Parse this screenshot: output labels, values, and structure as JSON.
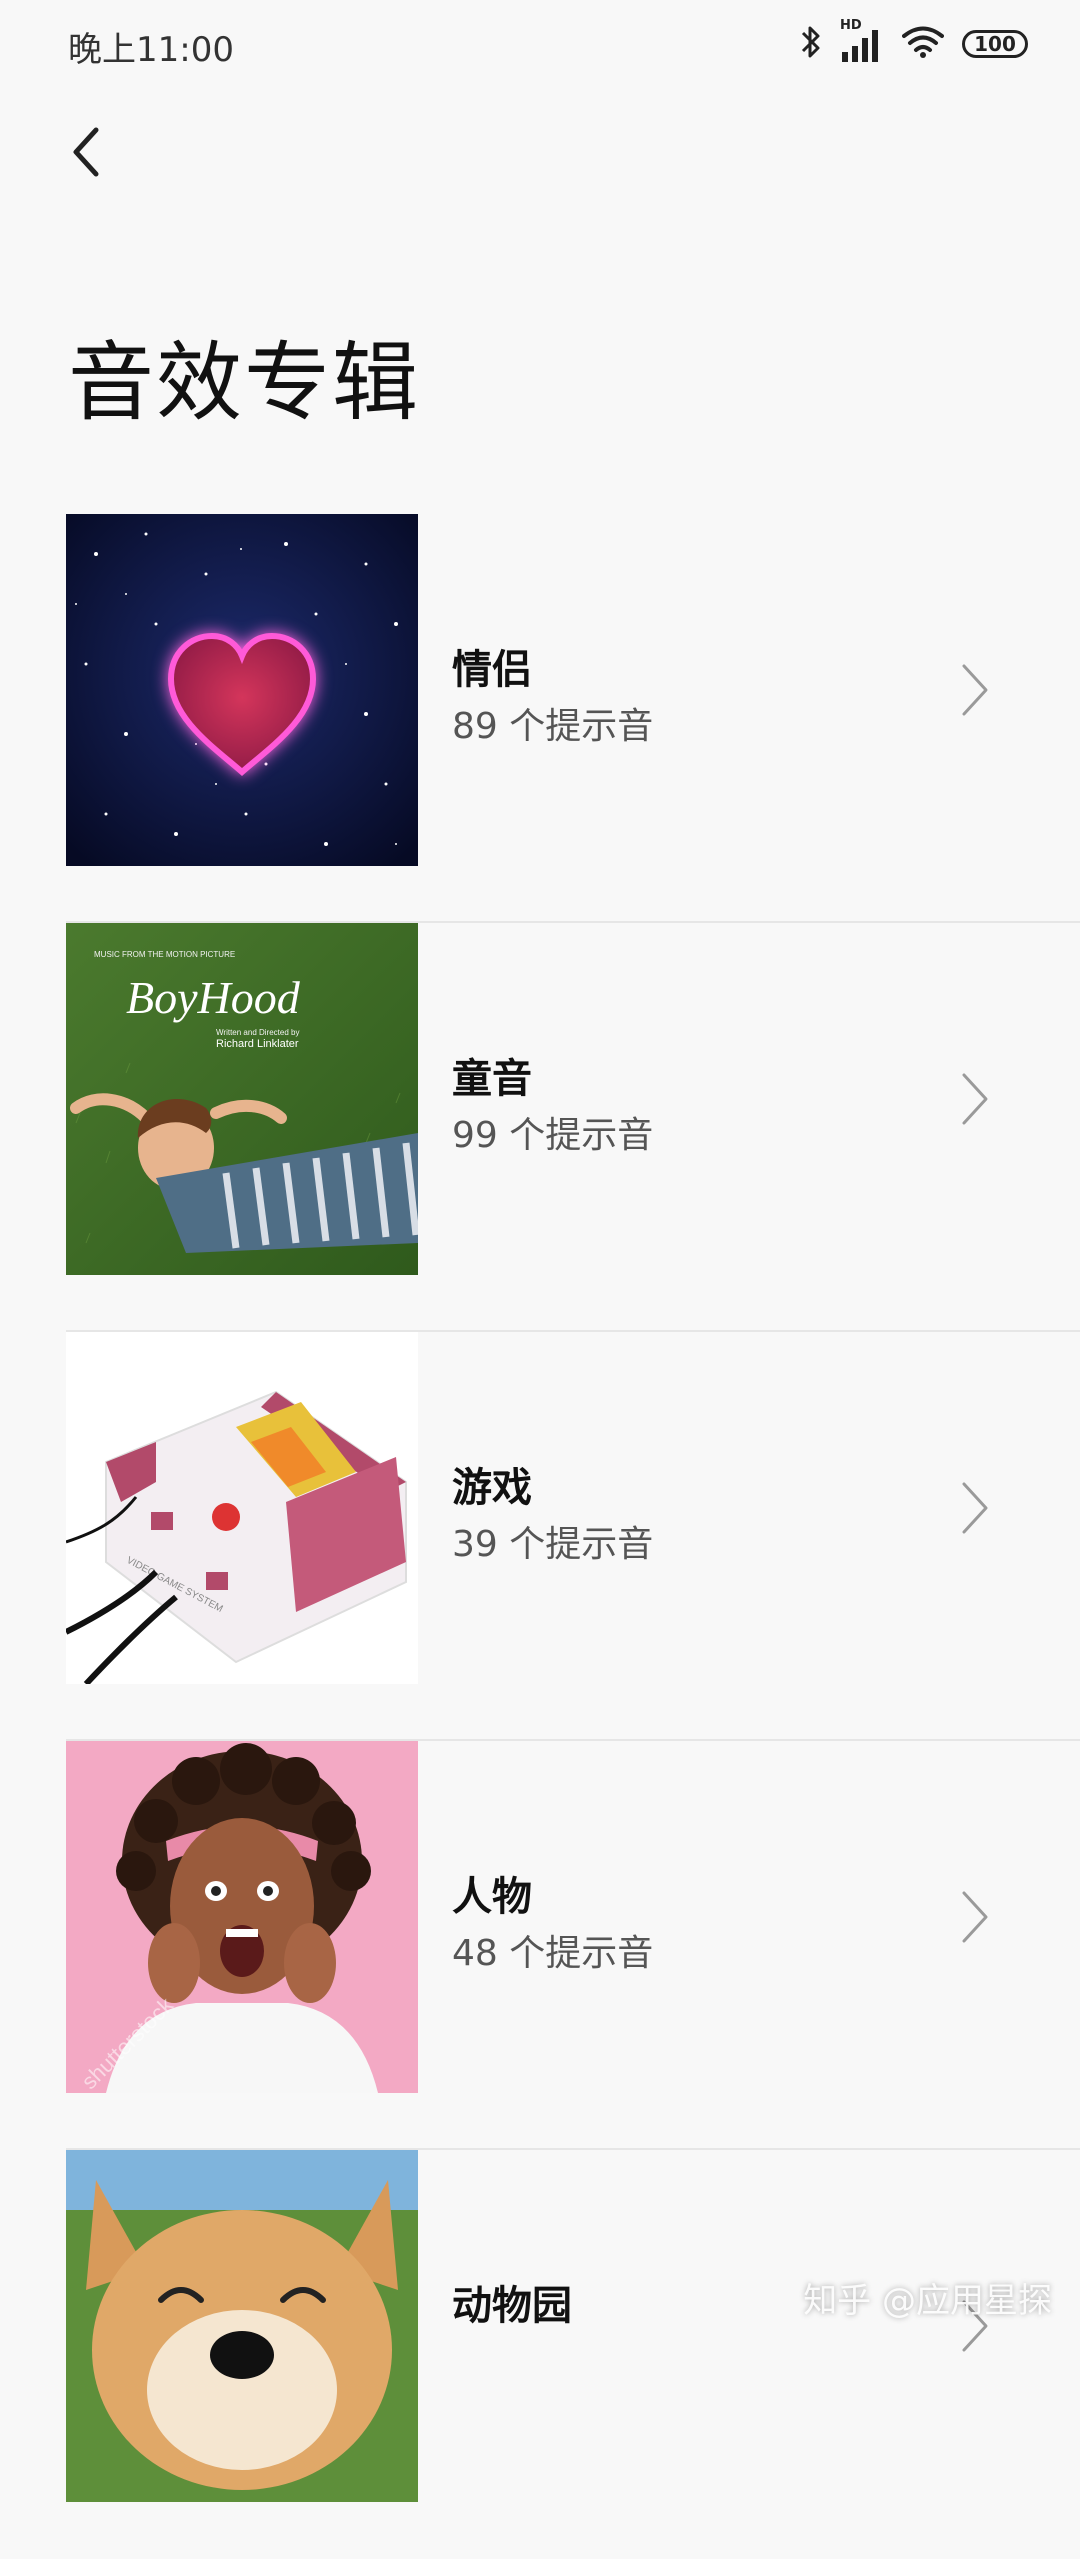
{
  "status_bar": {
    "time": "晚上11:00",
    "battery": "100",
    "network_badge": "HD",
    "icons": [
      "bluetooth-icon",
      "signal-icon",
      "wifi-icon",
      "battery-icon"
    ]
  },
  "header": {
    "back_icon": "chevron-left-icon",
    "title": "音效专辑"
  },
  "albums": [
    {
      "name": "情侣",
      "count": "89 个提示音",
      "art": "heart-in-space"
    },
    {
      "name": "童音",
      "count": "99 个提示音",
      "art": "boyhood-cover",
      "cover_text": {
        "top": "MUSIC FROM THE MOTION PICTURE",
        "title": "BoyHood",
        "credit": "Written and Directed by",
        "director": "Richard Linklater"
      }
    },
    {
      "name": "游戏",
      "count": "39 个提示音",
      "art": "retro-game-console",
      "cover_text": {
        "console_label": "VIDEO GAME SYSTEM"
      }
    },
    {
      "name": "人物",
      "count": "48 个提示音",
      "art": "shouting-woman",
      "cover_text": {
        "stock": "shutterstock"
      }
    },
    {
      "name": "动物园",
      "count": "",
      "art": "shiba-dog"
    }
  ],
  "watermark": "知乎 @应用星探",
  "colors": {
    "background": "#f8f8f8",
    "title": "#111111",
    "subtitle": "#555555",
    "divider": "#e6e6e6",
    "chevron": "#9a9a9a"
  }
}
